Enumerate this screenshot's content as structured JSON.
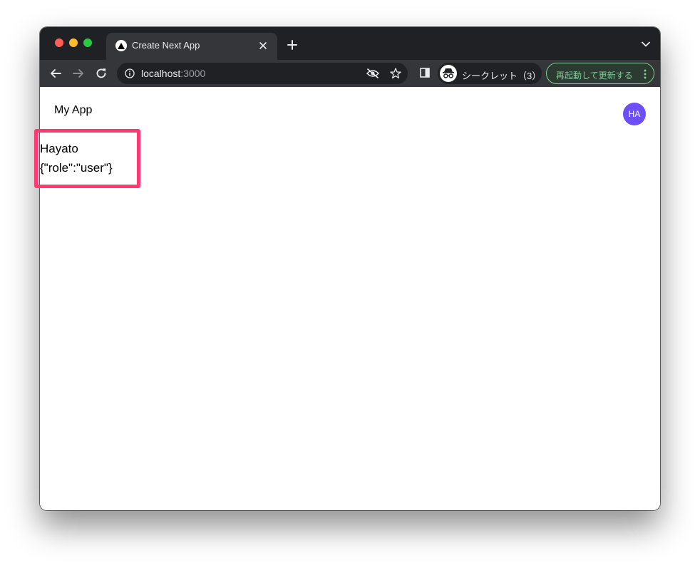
{
  "browser": {
    "tab": {
      "title": "Create Next App",
      "favicon": "nextjs-triangle-icon"
    },
    "toolbar": {
      "url_host": "localhost",
      "url_port": ":3000",
      "incognito_label": "シークレット（3）",
      "relaunch_label": "再起動して更新する"
    }
  },
  "app": {
    "title": "My App",
    "avatar_initials": "HA",
    "user": {
      "name": "Hayato",
      "metadata": "{\"role\":\"user\"}"
    }
  },
  "colors": {
    "avatar_bg": "#6d4ff7",
    "highlight_border": "#ff3a72",
    "relaunch_accent": "#81c995"
  }
}
